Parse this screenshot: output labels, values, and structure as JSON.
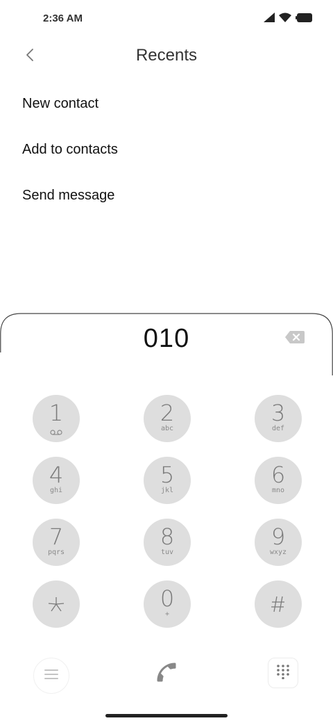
{
  "status_bar": {
    "time": "2:36 AM",
    "icons": [
      "signal-icon",
      "wifi-icon",
      "battery-icon"
    ]
  },
  "header": {
    "title": "Recents",
    "back_icon": "chevron-left-icon"
  },
  "menu": {
    "items": [
      {
        "label": "New contact"
      },
      {
        "label": "Add to contacts"
      },
      {
        "label": "Send message"
      }
    ]
  },
  "dialer": {
    "number": "010",
    "backspace_icon": "backspace-icon",
    "keys": [
      {
        "digit": "1",
        "letters": "",
        "icon": "voicemail-icon"
      },
      {
        "digit": "2",
        "letters": "abc"
      },
      {
        "digit": "3",
        "letters": "def"
      },
      {
        "digit": "4",
        "letters": "ghi"
      },
      {
        "digit": "5",
        "letters": "jkl"
      },
      {
        "digit": "6",
        "letters": "mno"
      },
      {
        "digit": "7",
        "letters": "pqrs"
      },
      {
        "digit": "8",
        "letters": "tuv"
      },
      {
        "digit": "9",
        "letters": "wxyz"
      },
      {
        "digit": "*",
        "letters": ""
      },
      {
        "digit": "0",
        "letters": "+"
      },
      {
        "digit": "#",
        "letters": ""
      }
    ]
  },
  "bottom_bar": {
    "menu_icon": "hamburger-menu-icon",
    "call_icon": "phone-icon",
    "keypad_icon": "dialpad-icon"
  },
  "colors": {
    "key_background": "#dedede",
    "key_text": "#7a7a7a",
    "icon_gray": "#888888"
  }
}
